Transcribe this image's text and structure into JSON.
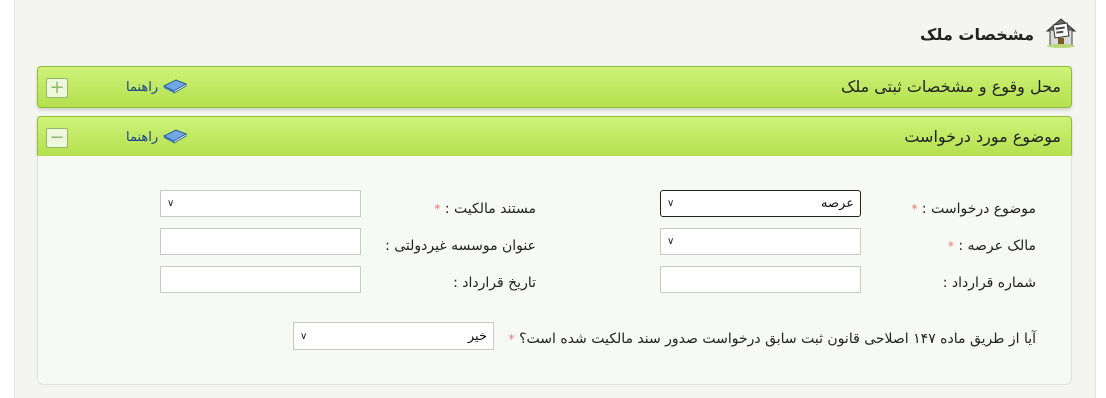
{
  "header": {
    "title": "مشخصات ملک",
    "icon": "house-document-icon"
  },
  "sections": [
    {
      "title": "محل وقوع و مشخصات ثبتی ملک",
      "help_label": "راهنما",
      "toggle_symbol": "+"
    },
    {
      "title": "موضوع مورد درخواست",
      "help_label": "راهنما",
      "toggle_symbol": "−"
    }
  ],
  "form": {
    "request_subject": {
      "label": "موضوع درخواست :",
      "required_mark": "*",
      "value": "عرصه"
    },
    "ownership_document": {
      "label": "مستند مالکیت :",
      "required_mark": "*",
      "value": ""
    },
    "land_owner": {
      "label": "مالک عرصه :",
      "required_mark": "*",
      "value": ""
    },
    "ngo_title": {
      "label": "عنوان موسسه غیردولتی :",
      "value": ""
    },
    "contract_number": {
      "label": "شماره قرارداد :",
      "value": ""
    },
    "contract_date": {
      "label": "تاریخ قرارداد :",
      "value": ""
    },
    "article147": {
      "label": "آیا از طریق ماده ۱۴۷ اصلاحی قانون ثبت سابق درخواست صدور سند مالکیت شده است؟",
      "required_mark": "*",
      "value": "خیر"
    }
  },
  "colors": {
    "bar_green": "#bfe860",
    "required_star": "#e77777",
    "help_link": "#1c3f8c"
  }
}
